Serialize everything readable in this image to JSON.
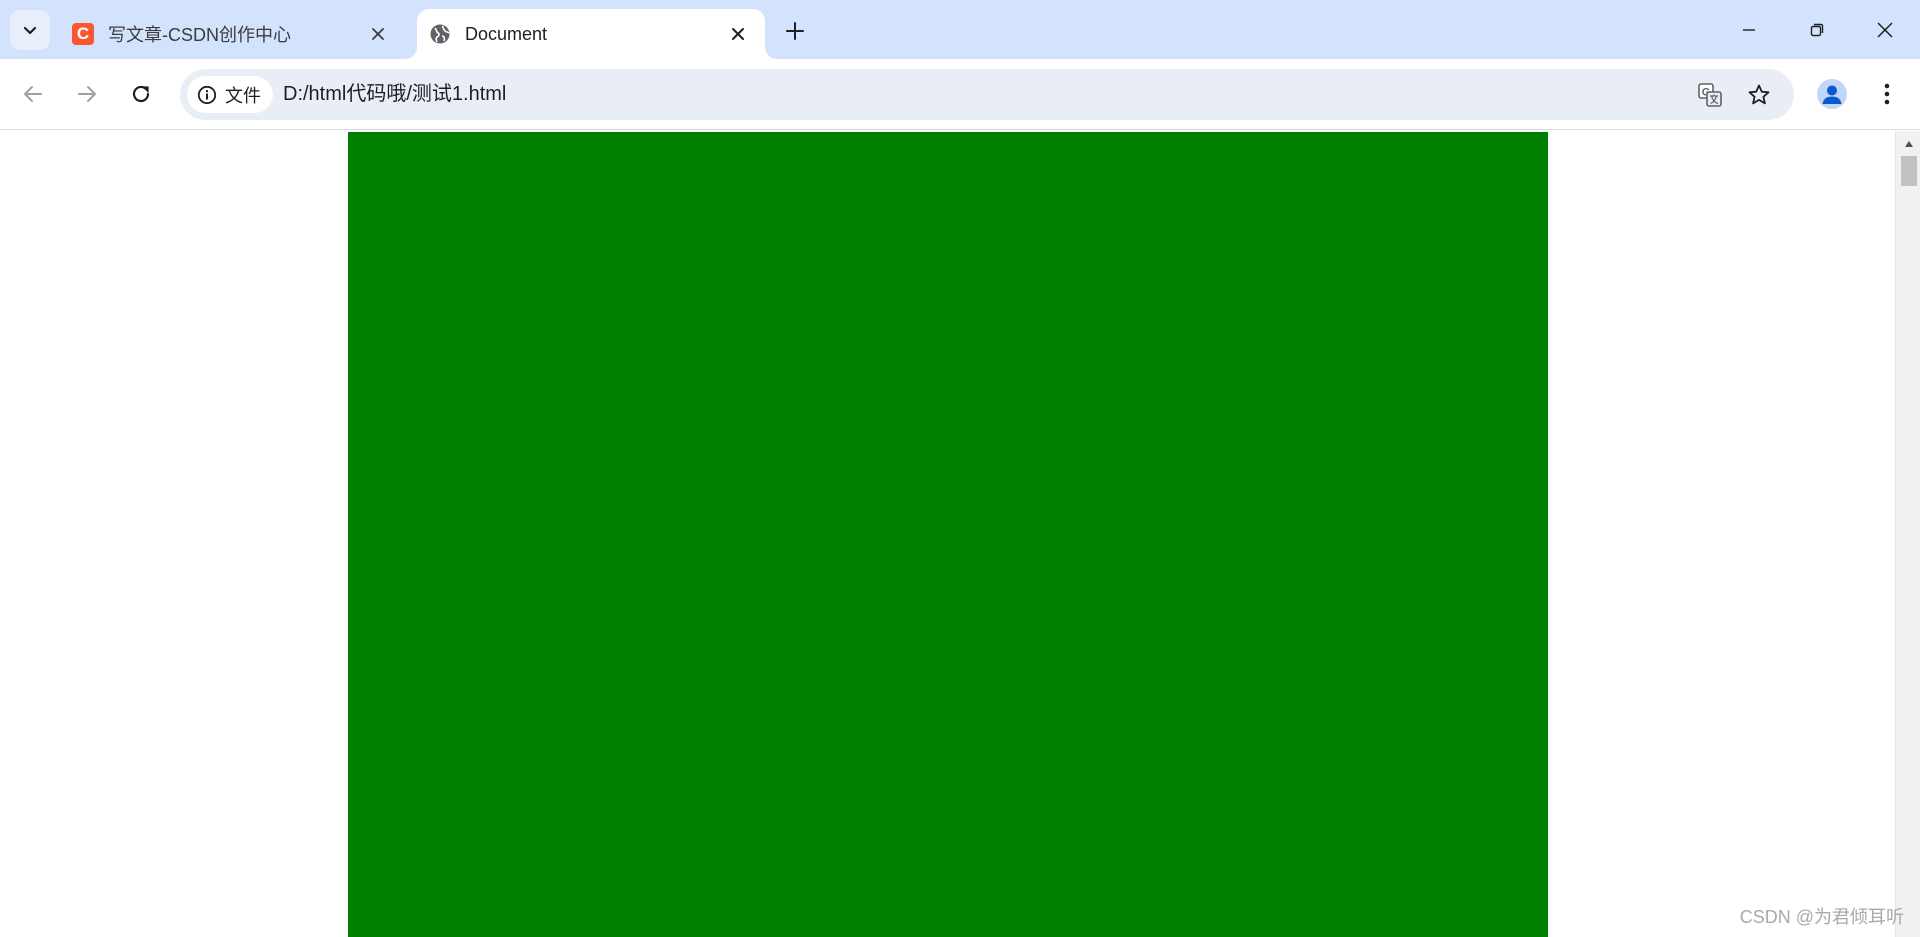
{
  "browser": {
    "tabs": [
      {
        "title": "写文章-CSDN创作中心",
        "favicon_letter": "C",
        "favicon_color": "#fc5531",
        "active": false
      },
      {
        "title": "Document",
        "favicon": "globe-icon",
        "active": true
      }
    ],
    "security_chip_label": "文件",
    "url": "D:/html代码哦/测试1.html",
    "tabstrip_color": "#d3e3fd",
    "omnibox_color": "#e9eef6"
  },
  "page": {
    "box_color": "#008000"
  },
  "watermark": "CSDN @为君倾耳听"
}
